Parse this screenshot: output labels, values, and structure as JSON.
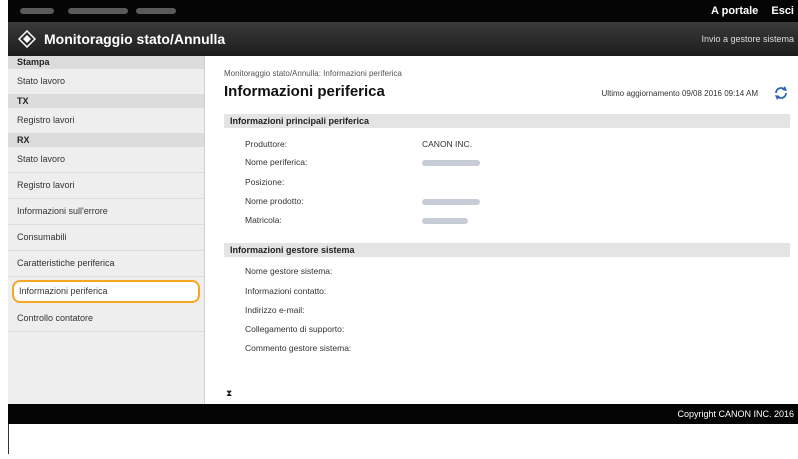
{
  "topbar": {
    "links": [
      "A portale",
      "Esci"
    ]
  },
  "titlebar": {
    "title": "Monitoraggio stato/Annulla",
    "admin_link": "Invio a gestore sistema"
  },
  "sidebar": {
    "groups": [
      {
        "header": "Stampa",
        "items": [
          "Stato lavoro"
        ]
      },
      {
        "header": "TX",
        "items": [
          "Registro lavori"
        ]
      },
      {
        "header": "RX",
        "items": [
          "Stato lavoro",
          "Registro lavori",
          "Informazioni sull'errore",
          "Consumabili",
          "Caratteristiche periferica",
          "Informazioni periferica",
          "Controllo contatore"
        ]
      }
    ],
    "selected": "Informazioni periferica"
  },
  "main": {
    "breadcrumb": "Monitoraggio stato/Annulla: Informazioni periferica",
    "title": "Informazioni periferica",
    "last_update": "Ultimo aggiornamento 09/08 2016 09:14 AM",
    "sections": [
      {
        "title": "Informazioni principali periferica",
        "rows": [
          {
            "label": "Produttore:",
            "value": "CANON INC."
          },
          {
            "label": "Nome periferica:",
            "value": ""
          },
          {
            "label": "Posizione:",
            "value": ""
          },
          {
            "label": "Nome prodotto:",
            "value": ""
          },
          {
            "label": "Matricola:",
            "value": ""
          }
        ]
      },
      {
        "title": "Informazioni gestore sistema",
        "rows": [
          {
            "label": "Nome gestore sistema:",
            "value": ""
          },
          {
            "label": "Informazioni contatto:",
            "value": ""
          },
          {
            "label": "Indirizzo e-mail:",
            "value": ""
          },
          {
            "label": "Collegamento di supporto:",
            "value": ""
          },
          {
            "label": "Commento gestore sistema:",
            "value": ""
          }
        ]
      }
    ]
  },
  "footer": {
    "copyright": "Copyright CANON INC. 2016"
  },
  "icons": {
    "logo": "canon-logo-icon",
    "refresh": "refresh-icon",
    "hourglass": "hourglass-icon"
  },
  "colors": {
    "highlight": "#f5a623",
    "topbar": "#050505",
    "section_header": "#e4e4e4"
  }
}
